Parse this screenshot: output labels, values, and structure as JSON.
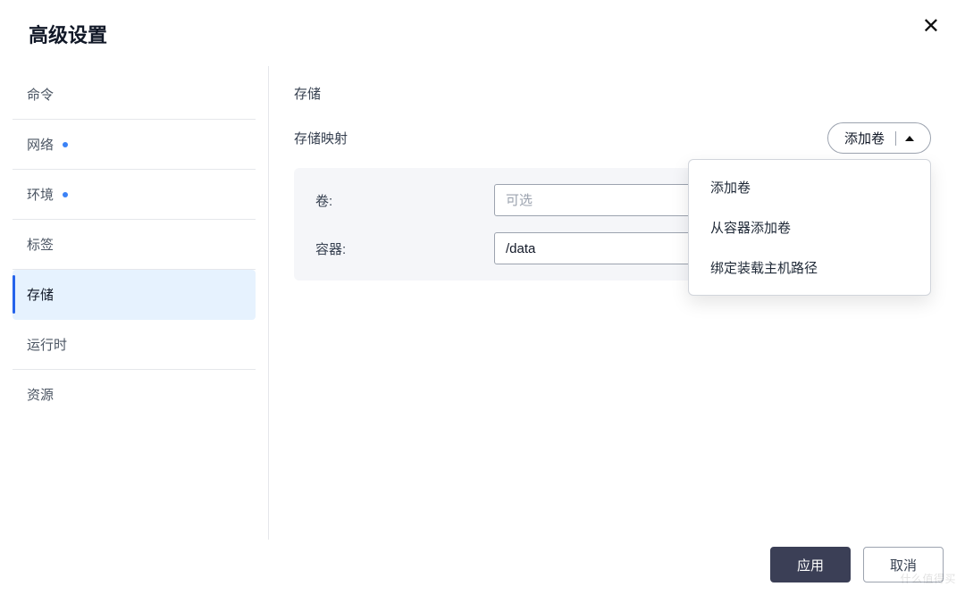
{
  "modal": {
    "title": "高级设置"
  },
  "sidebar": {
    "items": [
      {
        "label": "命令",
        "dot": false,
        "active": false
      },
      {
        "label": "网络",
        "dot": true,
        "active": false
      },
      {
        "label": "环境",
        "dot": true,
        "active": false
      },
      {
        "label": "标签",
        "dot": false,
        "active": false
      },
      {
        "label": "存储",
        "dot": false,
        "active": true
      },
      {
        "label": "运行时",
        "dot": false,
        "active": false
      },
      {
        "label": "资源",
        "dot": false,
        "active": false
      }
    ]
  },
  "content": {
    "section_title": "存储",
    "mapping_label": "存储映射",
    "add_button_label": "添加卷",
    "form": {
      "volume_label": "卷:",
      "volume_placeholder": "可选",
      "volume_value": "",
      "container_label": "容器:",
      "container_value": "/data"
    },
    "dropdown": {
      "items": [
        "添加卷",
        "从容器添加卷",
        "绑定装载主机路径"
      ]
    }
  },
  "footer": {
    "apply": "应用",
    "cancel": "取消"
  },
  "watermark": "什么值得买"
}
